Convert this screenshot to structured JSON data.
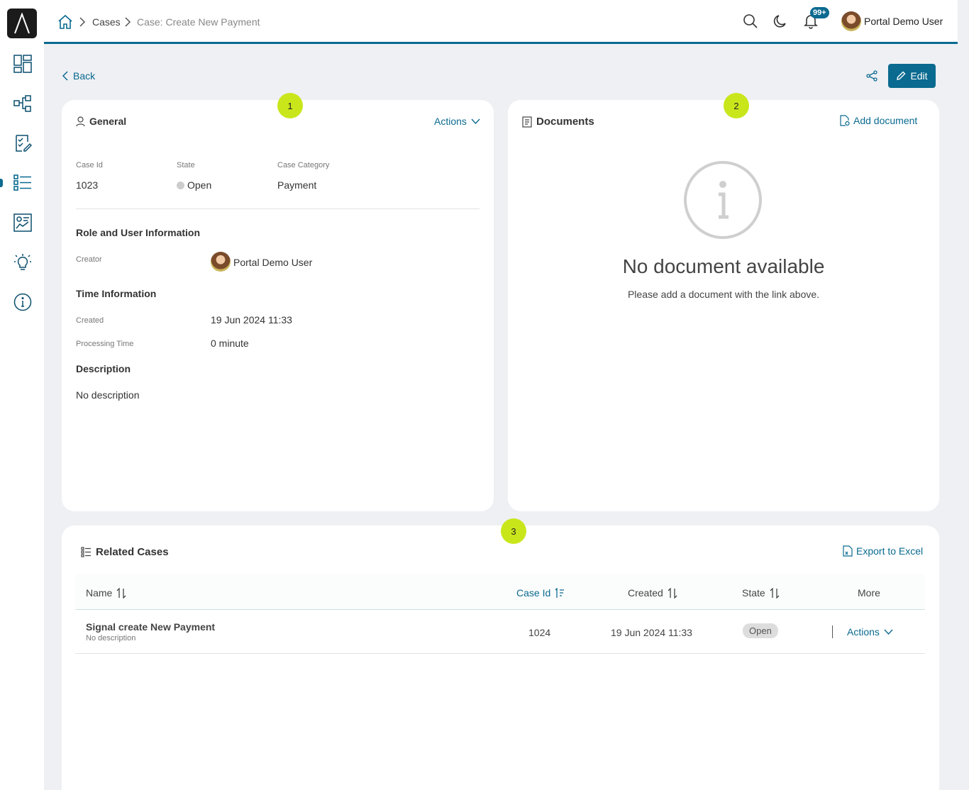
{
  "sidebar": {
    "icons": [
      "dashboard-icon",
      "process-icon",
      "tasks-icon",
      "cases-icon",
      "statistics-icon",
      "ideas-icon",
      "about-icon"
    ]
  },
  "header": {
    "breadcrumb": [
      "Cases",
      "Case: Create New Payment"
    ],
    "notification_count": "99+",
    "user_name": "Portal Demo User"
  },
  "toolbar": {
    "back_label": "Back",
    "edit_label": "Edit"
  },
  "steps": [
    "1",
    "2",
    "3"
  ],
  "general": {
    "title": "General",
    "actions_label": "Actions",
    "case_id_label": "Case Id",
    "case_id": "1023",
    "state_label": "State",
    "state": "Open",
    "category_label": "Case Category",
    "category": "Payment",
    "role_section": "Role and User Information",
    "creator_label": "Creator",
    "creator": "Portal Demo User",
    "time_section": "Time Information",
    "created_label": "Created",
    "created": "19 Jun 2024 11:33",
    "processing_label": "Processing Time",
    "processing": "0 minute",
    "description_section": "Description",
    "description": "No description"
  },
  "documents": {
    "title": "Documents",
    "add_label": "Add document",
    "empty_title": "No document available",
    "empty_text": "Please add a document with the link above."
  },
  "related": {
    "title": "Related Cases",
    "export_label": "Export to Excel",
    "columns": [
      "Name",
      "Case Id",
      "Created",
      "State",
      "More"
    ],
    "rows": [
      {
        "name": "Signal create New Payment",
        "description": "No description",
        "case_id": "1024",
        "created": "19 Jun 2024 11:33",
        "state": "Open",
        "actions": "Actions"
      }
    ]
  },
  "colors": {
    "accent": "#0a6a90",
    "step_marker": "#c9e61b"
  }
}
